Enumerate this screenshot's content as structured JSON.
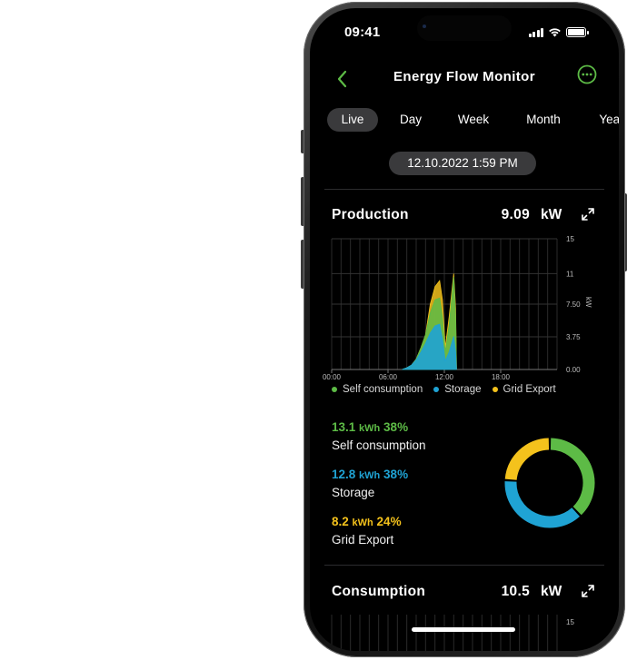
{
  "status": {
    "time": "09:41"
  },
  "nav": {
    "title": "Energy Flow Monitor"
  },
  "tabs": [
    {
      "label": "Live",
      "active": true
    },
    {
      "label": "Day"
    },
    {
      "label": "Week"
    },
    {
      "label": "Month"
    },
    {
      "label": "Year"
    }
  ],
  "date_label": "12.10.2022  1:59 PM",
  "production": {
    "title": "Production",
    "value": "9.09",
    "unit": "kW",
    "legend": [
      {
        "label": "Self consumption",
        "color": "#5dbb46"
      },
      {
        "label": "Storage",
        "color": "#1fa3d4"
      },
      {
        "label": "Grid Export",
        "color": "#f4c21c"
      }
    ],
    "stats": [
      {
        "value": "13.1",
        "unit": "kWh",
        "pct": "38%",
        "label": "Self consumption",
        "color": "#5dbb46"
      },
      {
        "value": "12.8",
        "unit": "kWh",
        "pct": "38%",
        "label": "Storage",
        "color": "#1fa3d4"
      },
      {
        "value": "8.2",
        "unit": "kWh",
        "pct": "24%",
        "label": "Grid Export",
        "color": "#f4c21c"
      }
    ]
  },
  "chart_data": {
    "type": "area",
    "x": [
      "00:00",
      "06:00",
      "12:00",
      "18:00"
    ],
    "xlim": [
      0,
      24
    ],
    "ylabel": "kW",
    "y_ticks": [
      "15",
      "11",
      "7.50",
      "3.75",
      "0.00"
    ],
    "ylim": [
      0,
      15
    ],
    "grid": true,
    "series": [
      {
        "name": "Self consumption",
        "color": "#5dbb46",
        "points": [
          [
            7.5,
            0
          ],
          [
            8,
            0.2
          ],
          [
            8.5,
            0.5
          ],
          [
            9,
            1.2
          ],
          [
            9.5,
            2.5
          ],
          [
            10,
            4
          ],
          [
            10.5,
            6.5
          ],
          [
            11,
            8
          ],
          [
            11.5,
            8.2
          ],
          [
            11.8,
            6
          ],
          [
            12.1,
            2
          ],
          [
            12.5,
            5
          ],
          [
            13,
            10.6
          ],
          [
            13.2,
            6
          ],
          [
            13.3,
            0
          ]
        ]
      },
      {
        "name": "Storage",
        "color": "#1fa3d4",
        "points": [
          [
            7.5,
            0
          ],
          [
            8,
            0.2
          ],
          [
            8.5,
            0.5
          ],
          [
            9,
            1.1
          ],
          [
            9.5,
            2
          ],
          [
            10,
            3
          ],
          [
            10.5,
            4.2
          ],
          [
            11,
            5
          ],
          [
            11.5,
            5.2
          ],
          [
            11.8,
            3.5
          ],
          [
            12.1,
            1
          ],
          [
            12.5,
            2
          ],
          [
            13,
            3.8
          ],
          [
            13.2,
            2
          ],
          [
            13.3,
            0
          ]
        ]
      },
      {
        "name": "Grid Export",
        "color": "#f4c21c",
        "points": [
          [
            7.5,
            0
          ],
          [
            8,
            0.2
          ],
          [
            8.5,
            0.5
          ],
          [
            9,
            1.2
          ],
          [
            9.5,
            2.5
          ],
          [
            10,
            4
          ],
          [
            10.5,
            7.5
          ],
          [
            11,
            9.5
          ],
          [
            11.5,
            10.2
          ],
          [
            11.8,
            8
          ],
          [
            12.1,
            2.5
          ],
          [
            12.5,
            6
          ],
          [
            13,
            11
          ],
          [
            13.2,
            7
          ],
          [
            13.3,
            0
          ]
        ]
      }
    ]
  },
  "donut_data": {
    "type": "pie",
    "categories": [
      "Self consumption",
      "Storage",
      "Grid Export"
    ],
    "values": [
      38,
      38,
      24
    ],
    "colors": [
      "#5dbb46",
      "#1fa3d4",
      "#f4c21c"
    ]
  },
  "consumption": {
    "title": "Consumption",
    "value": "10.5",
    "unit": "kW",
    "top_tick": "15"
  }
}
